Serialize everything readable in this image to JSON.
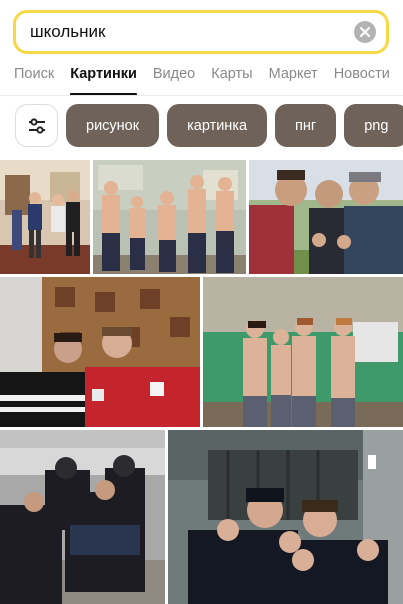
{
  "search": {
    "value": "школьник",
    "clear_icon": "close-icon"
  },
  "tabs": [
    {
      "label": "Поиск",
      "active": false
    },
    {
      "label": "Картинки",
      "active": true
    },
    {
      "label": "Видео",
      "active": false
    },
    {
      "label": "Карты",
      "active": false
    },
    {
      "label": "Маркет",
      "active": false
    },
    {
      "label": "Новости",
      "active": false
    }
  ],
  "filters": {
    "icon": "sliders-icon"
  },
  "chips": [
    "рисунок",
    "картинка",
    "пнг",
    "png"
  ],
  "colors": {
    "accent": "#f6d845",
    "chip_bg": "#6f6258",
    "active_tab": "#111111"
  },
  "images": [
    {
      "name": "photo-1",
      "desc": "group of boys in room"
    },
    {
      "name": "photo-2",
      "desc": "shirtless boys in classroom"
    },
    {
      "name": "photo-3",
      "desc": "boys outdoors close-up"
    },
    {
      "name": "photo-4",
      "desc": "boys on sofa with carpet"
    },
    {
      "name": "photo-5",
      "desc": "shirtless boys by green wall"
    },
    {
      "name": "photo-6",
      "desc": "boys in winter jackets outdoors"
    },
    {
      "name": "photo-7",
      "desc": "boys in doorway fists raised"
    }
  ]
}
